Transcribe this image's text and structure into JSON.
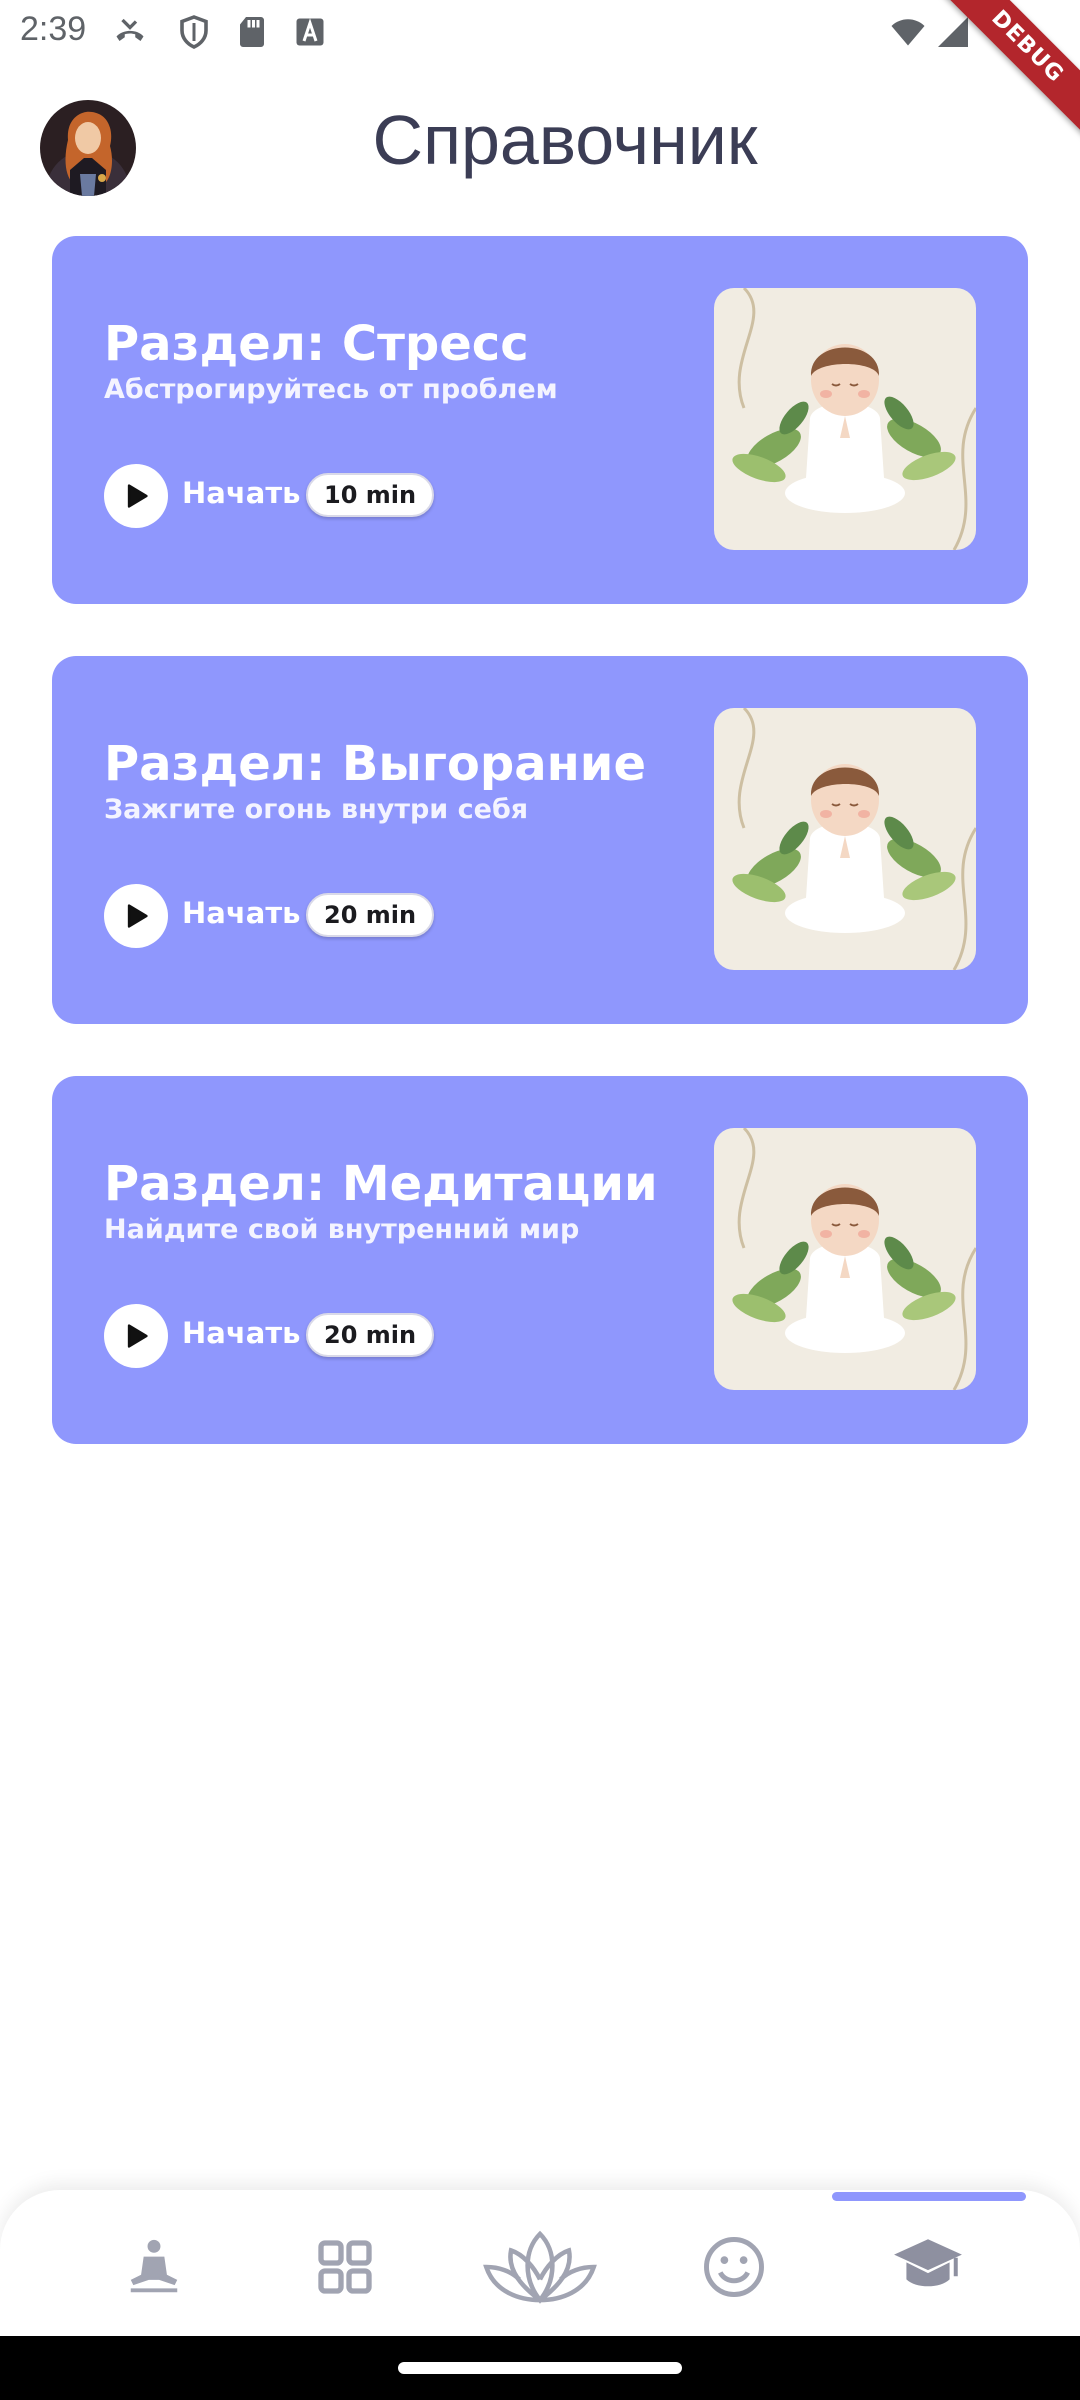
{
  "status_bar": {
    "time": "2:39",
    "left_icons": [
      "missed-call-icon",
      "shield-icon",
      "sd-card-icon",
      "font-a-icon"
    ],
    "right_icons": [
      "wifi-icon",
      "signal-icon"
    ]
  },
  "debug_banner": "DEBUG",
  "header": {
    "title": "Справочник",
    "avatar_icon": "user-avatar"
  },
  "cards": [
    {
      "title": "Раздел: Стресс",
      "subtitle": "Абстрогируйтесь от проблем",
      "start_label": "Начать",
      "duration": "10 min",
      "illustration": "meditating-child-illustration"
    },
    {
      "title": "Раздел: Выгорание",
      "subtitle": "Зажгите огонь внутри себя",
      "start_label": "Начать",
      "duration": "20 min",
      "illustration": "meditating-child-illustration"
    },
    {
      "title": "Раздел: Медитации",
      "subtitle": "Найдите свой внутренний мир",
      "start_label": "Начать",
      "duration": "20 min",
      "illustration": "meditating-child-illustration"
    }
  ],
  "bottom_nav": {
    "items": [
      "meditation-person-icon",
      "grid-icon",
      "lotus-icon",
      "smiley-icon",
      "graduation-cap-icon"
    ],
    "active_index": 4
  },
  "colors": {
    "card_background": "#8f97fd",
    "title_text": "#3b3d55",
    "nav_icon": "#a1a4b2",
    "nav_active_icon": "#8e90a0",
    "illustration_background": "#f1ece2"
  }
}
